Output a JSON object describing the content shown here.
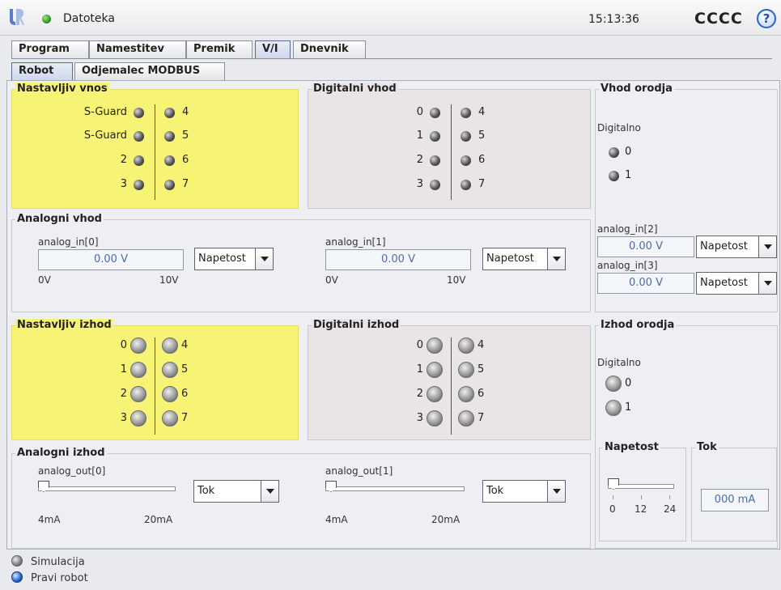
{
  "header": {
    "file_menu": "Datoteka",
    "clock": "15:13:36",
    "robot_name": "CCCC",
    "help": "?"
  },
  "main_tabs": [
    "Program",
    "Namestitev",
    "Premik",
    "V/I",
    "Dnevnik"
  ],
  "main_active_tab": "V/I",
  "sub_tabs": [
    "Robot",
    "Odjemalec MODBUS"
  ],
  "sub_active_tab": "Robot",
  "configurable_input": {
    "title": "Nastavljiv vnos",
    "left": [
      "S-Guard",
      "S-Guard",
      "2",
      "3"
    ],
    "right": [
      "4",
      "5",
      "6",
      "7"
    ]
  },
  "digital_input": {
    "title": "Digitalni vhod",
    "left": [
      "0",
      "1",
      "2",
      "3"
    ],
    "right": [
      "4",
      "5",
      "6",
      "7"
    ]
  },
  "tool_input": {
    "title": "Vhod orodja",
    "digital_label": "Digitalno",
    "pins": [
      "0",
      "1"
    ],
    "analog": [
      {
        "label": "analog_in[2]",
        "value": "0.00 V",
        "mode": "Napetost"
      },
      {
        "label": "analog_in[3]",
        "value": "0.00 V",
        "mode": "Napetost"
      }
    ]
  },
  "analog_input": {
    "title": "Analogni vhod",
    "channels": [
      {
        "label": "analog_in[0]",
        "value": "0.00 V",
        "mode": "Napetost",
        "min": "0V",
        "max": "10V"
      },
      {
        "label": "analog_in[1]",
        "value": "0.00 V",
        "mode": "Napetost",
        "min": "0V",
        "max": "10V"
      }
    ]
  },
  "configurable_output": {
    "title": "Nastavljiv izhod",
    "left": [
      "0",
      "1",
      "2",
      "3"
    ],
    "right": [
      "4",
      "5",
      "6",
      "7"
    ]
  },
  "digital_output": {
    "title": "Digitalni izhod",
    "left": [
      "0",
      "1",
      "2",
      "3"
    ],
    "right": [
      "4",
      "5",
      "6",
      "7"
    ]
  },
  "tool_output": {
    "title": "Izhod orodja",
    "digital_label": "Digitalno",
    "pins": [
      "0",
      "1"
    ],
    "voltage": {
      "title": "Napetost",
      "ticks": [
        "0",
        "12",
        "24"
      ],
      "level": 0
    },
    "current": {
      "title": "Tok",
      "value": "000 mA"
    }
  },
  "analog_output": {
    "title": "Analogni izhod",
    "channels": [
      {
        "label": "analog_out[0]",
        "mode": "Tok",
        "min": "4mA",
        "max": "20mA",
        "level": 0
      },
      {
        "label": "analog_out[1]",
        "mode": "Tok",
        "min": "4mA",
        "max": "20mA",
        "level": 0
      }
    ]
  },
  "footer": {
    "simulation": "Simulacija",
    "real_robot": "Pravi robot"
  }
}
